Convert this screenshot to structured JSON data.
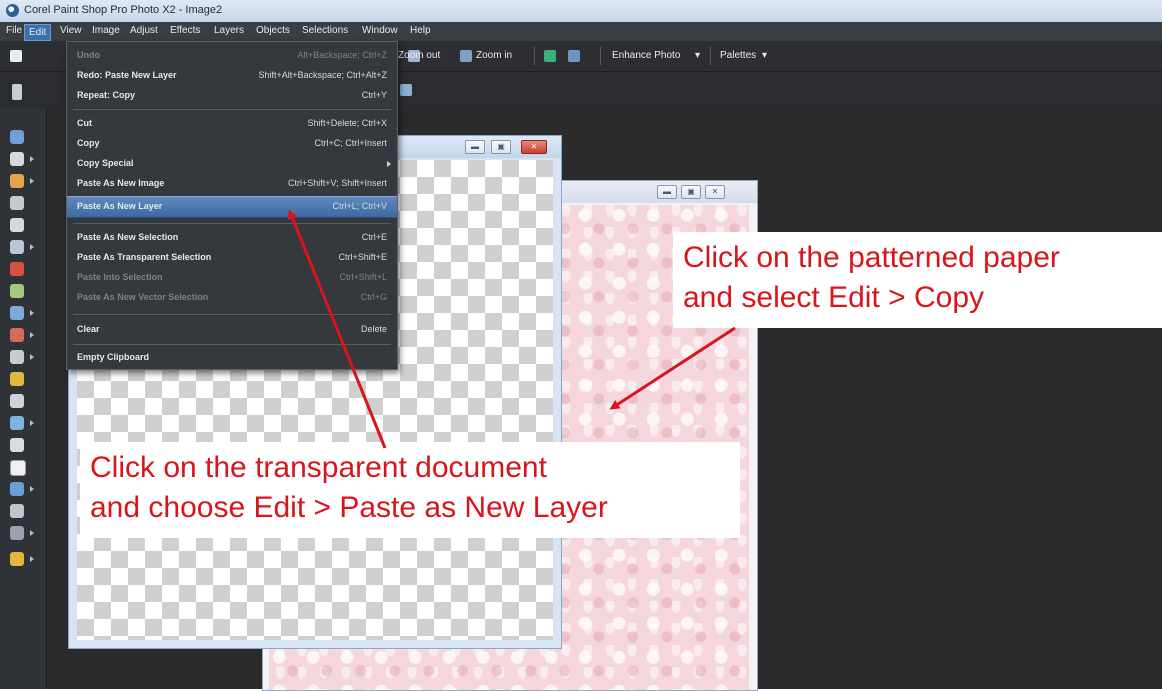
{
  "window": {
    "title": "Corel Paint Shop Pro Photo X2 - Image2"
  },
  "menubar": {
    "items": [
      "File",
      "Edit",
      "View",
      "Image",
      "Adjust",
      "Effects",
      "Layers",
      "Objects",
      "Selections",
      "Window",
      "Help"
    ]
  },
  "toolbar": {
    "zoom_out": "Zoom out",
    "zoom_in": "Zoom in",
    "enhance_photo": "Enhance Photo",
    "palettes": "Palettes"
  },
  "edit_menu": {
    "items": [
      {
        "label": "Undo",
        "shortcut": "Alt+Backspace; Ctrl+Z",
        "enabled": false
      },
      {
        "label": "Redo: Paste New Layer",
        "shortcut": "Shift+Alt+Backspace; Ctrl+Alt+Z",
        "enabled": true
      },
      {
        "label": "Repeat: Copy",
        "shortcut": "Ctrl+Y",
        "enabled": true
      },
      {
        "label": "Cut",
        "shortcut": "Shift+Delete; Ctrl+X",
        "enabled": true
      },
      {
        "label": "Copy",
        "shortcut": "Ctrl+C; Ctrl+Insert",
        "enabled": true
      },
      {
        "label": "Copy Special",
        "shortcut": "",
        "enabled": true,
        "submenu": true
      },
      {
        "label": "Paste As New Image",
        "shortcut": "Ctrl+Shift+V; Shift+Insert",
        "enabled": true
      },
      {
        "label": "Paste As New Layer",
        "shortcut": "Ctrl+L; Ctrl+V",
        "enabled": true,
        "highlighted": true
      },
      {
        "label": "Paste As New Selection",
        "shortcut": "Ctrl+E",
        "enabled": true
      },
      {
        "label": "Paste As Transparent Selection",
        "shortcut": "Ctrl+Shift+E",
        "enabled": true
      },
      {
        "label": "Paste Into Selection",
        "shortcut": "Ctrl+Shift+L",
        "enabled": false
      },
      {
        "label": "Paste As New Vector Selection",
        "shortcut": "Ctrl+G",
        "enabled": false
      },
      {
        "label": "Clear",
        "shortcut": "Delete",
        "enabled": true
      },
      {
        "label": "Empty Clipboard",
        "shortcut": "",
        "enabled": true
      }
    ]
  },
  "annotations": {
    "paper": {
      "line1": "Click on the patterned paper",
      "line2": "and select Edit > Copy"
    },
    "transparent": {
      "line1": "Click on the transparent document",
      "line2": "and choose Edit > Paste as New Layer"
    }
  },
  "colors": {
    "annotation_text": "#d9141a",
    "menu_highlight": "#4a78b3",
    "workspace": "#2b2b2b",
    "paper_pink": "#f5d6dc"
  }
}
